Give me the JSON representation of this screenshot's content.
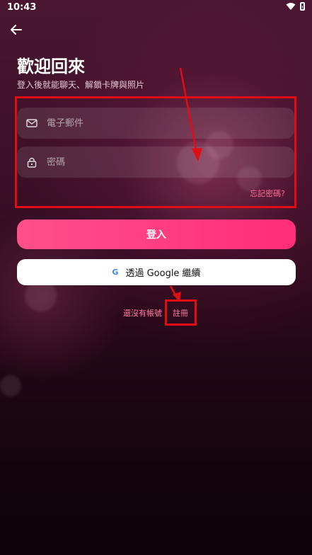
{
  "status": {
    "time": "10:43"
  },
  "header": {
    "title": "歡迎回來",
    "subtitle": "登入後就能聊天、解鎖卡牌與照片"
  },
  "form": {
    "email_placeholder": "電子郵件",
    "password_placeholder": "密碼",
    "forgot_password": "忘記密碼?"
  },
  "actions": {
    "login_label": "登入",
    "google_icon_label": "G",
    "google_label": "透過 Google 繼續"
  },
  "footer": {
    "no_account": "還沒有帳號",
    "register": "註冊"
  },
  "colors": {
    "accent": "#ff2d78",
    "annotation": "#e20d14",
    "link": "#ff7ba4"
  },
  "icons": [
    "back-arrow-icon",
    "wifi-icon",
    "battery-icon",
    "mail-icon",
    "lock-icon",
    "google-icon"
  ]
}
